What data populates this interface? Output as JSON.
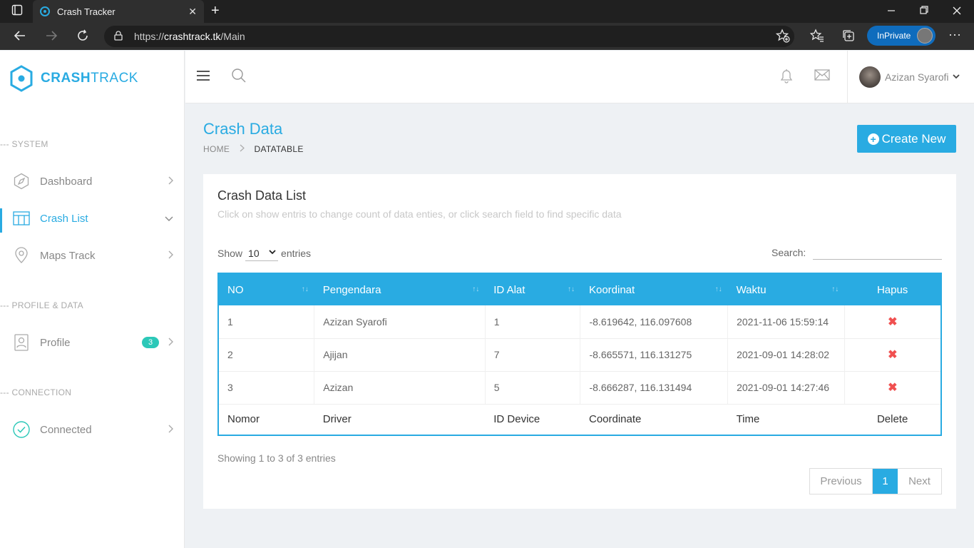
{
  "browser": {
    "tab_title": "Crash Tracker",
    "tab_close": "✕",
    "url_scheme": "https://",
    "url_host": "crashtrack.tk",
    "url_path": "/Main",
    "inprivate_label": "InPrivate"
  },
  "logo": {
    "bold": "CRASH",
    "light": "TRACK"
  },
  "sidebar": {
    "sections": {
      "system": "--- SYSTEM",
      "profile_data": "--- PROFILE & DATA",
      "connection": "--- CONNECTION"
    },
    "items": [
      {
        "label": "Dashboard",
        "icon": "compass-icon"
      },
      {
        "label": "Crash List",
        "icon": "table-icon",
        "active": true
      },
      {
        "label": "Maps Track",
        "icon": "map-pin-icon"
      },
      {
        "label": "Profile",
        "icon": "profile-card-icon",
        "badge": "3"
      },
      {
        "label": "Connected",
        "icon": "check-circle-icon"
      }
    ]
  },
  "header": {
    "user_name": "Azizan Syarofi"
  },
  "page": {
    "title": "Crash Data",
    "breadcrumb": [
      "HOME",
      "DATATABLE"
    ],
    "create_button": "Create New"
  },
  "card": {
    "title": "Crash Data List",
    "subtitle": "Click on show entris to change count of data enties, or click search field to find specific data",
    "show_label": "Show",
    "show_value": "10",
    "entries_label": "entries",
    "search_label": "Search:"
  },
  "table": {
    "headers": [
      "NO",
      "Pengendara",
      "ID Alat",
      "Koordinat",
      "Waktu",
      "Hapus"
    ],
    "footers": [
      "Nomor",
      "Driver",
      "ID Device",
      "Coordinate",
      "Time",
      "Delete"
    ],
    "rows": [
      [
        "1",
        "Azizan Syarofi",
        "1",
        "-8.619642, 116.097608",
        "2021-11-06 15:59:14"
      ],
      [
        "2",
        "Ajijan",
        "7",
        "-8.665571, 116.131275",
        "2021-09-01 14:28:02"
      ],
      [
        "3",
        "Azizan",
        "5",
        "-8.666287, 116.131494",
        "2021-09-01 14:27:46"
      ]
    ],
    "delete_symbol": "✖"
  },
  "footer_info": "Showing 1 to 3 of 3 entries",
  "pagination": {
    "previous": "Previous",
    "page": "1",
    "next": "Next"
  },
  "colors": {
    "accent": "#29abe2",
    "delete": "#f05050",
    "badge": "#2cc8b8"
  }
}
